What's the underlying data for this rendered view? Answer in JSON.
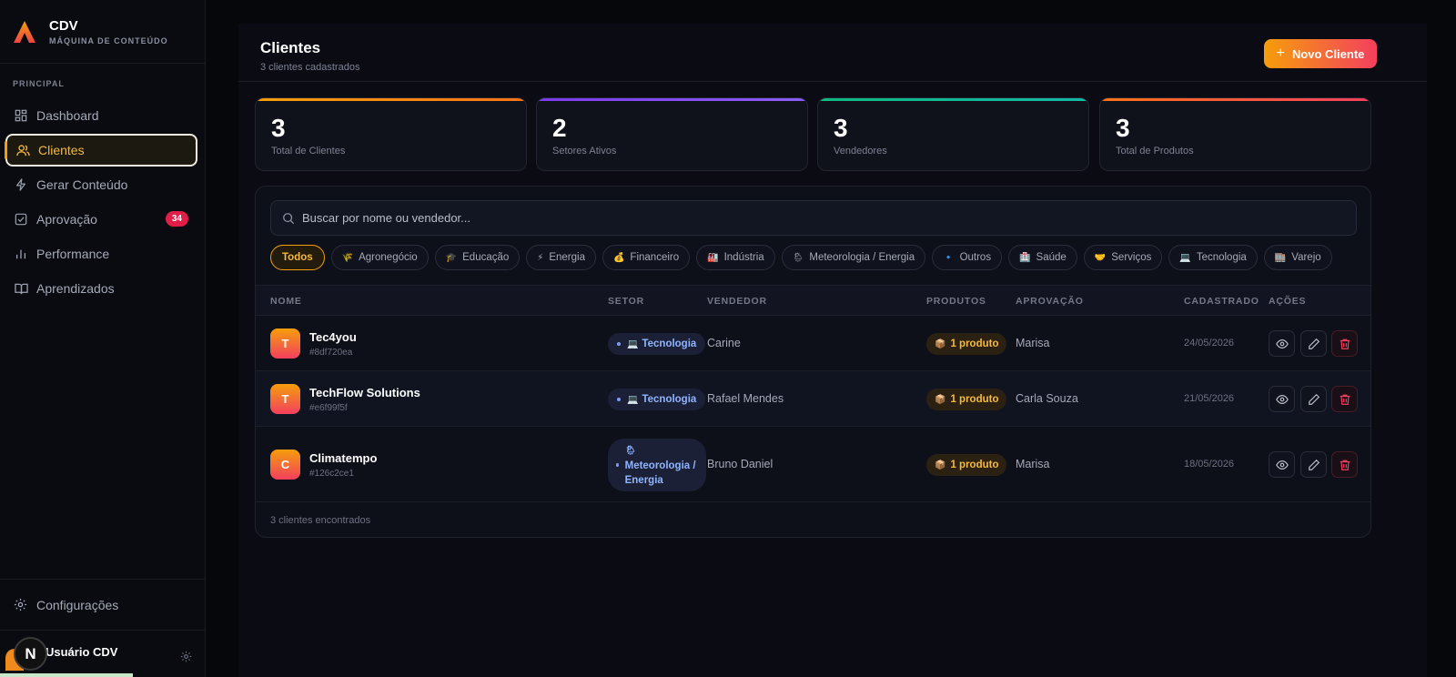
{
  "brand": {
    "name": "CDV",
    "subtitle": "MÁQUINA DE CONTEÚDO"
  },
  "sidebar": {
    "section_label": "PRINCIPAL",
    "items": [
      {
        "label": "Dashboard",
        "icon": "grid-icon"
      },
      {
        "label": "Clientes",
        "icon": "users-icon",
        "active": true
      },
      {
        "label": "Gerar Conteúdo",
        "icon": "bolt-icon"
      },
      {
        "label": "Aprovação",
        "icon": "check-square-icon",
        "badge": "34"
      },
      {
        "label": "Performance",
        "icon": "bar-chart-icon"
      },
      {
        "label": "Aprendizados",
        "icon": "book-icon"
      }
    ],
    "settings_label": "Configurações",
    "user_name": "Usuário CDV",
    "user_initial": "N"
  },
  "page": {
    "title": "Clientes",
    "subtitle": "3 clientes cadastrados",
    "new_button": "Novo Cliente",
    "new_button_icon": "+"
  },
  "stats": [
    {
      "value": "3",
      "label": "Total de Clientes",
      "color": "#f59e0b"
    },
    {
      "value": "2",
      "label": "Setores Ativos",
      "color": "#8b5cf6"
    },
    {
      "value": "3",
      "label": "Vendedores",
      "color": "#10b981"
    },
    {
      "value": "3",
      "label": "Total de Produtos",
      "color": "#f43f5e"
    }
  ],
  "search": {
    "placeholder": "Buscar por nome ou vendedor..."
  },
  "filters": [
    {
      "label": "Todos",
      "emoji": "",
      "active": true
    },
    {
      "label": "Agronegócio",
      "emoji": "🌾"
    },
    {
      "label": "Educação",
      "emoji": "🎓"
    },
    {
      "label": "Energia",
      "emoji": "⚡"
    },
    {
      "label": "Financeiro",
      "emoji": "💰"
    },
    {
      "label": "Indústria",
      "emoji": "🏭"
    },
    {
      "label": "Meteorologia / Energia",
      "emoji": "🌦"
    },
    {
      "label": "Outros",
      "emoji": "🔹"
    },
    {
      "label": "Saúde",
      "emoji": "🏥"
    },
    {
      "label": "Serviços",
      "emoji": "🤝"
    },
    {
      "label": "Tecnologia",
      "emoji": "💻"
    },
    {
      "label": "Varejo",
      "emoji": "🏬"
    }
  ],
  "table": {
    "headers": [
      "NOME",
      "SETOR",
      "VENDEDOR",
      "PRODUTOS",
      "APROVAÇÃO",
      "CADASTRADO",
      "AÇÕES"
    ],
    "rows": [
      {
        "initial": "T",
        "name": "Tec4you",
        "id": "#8df720ea",
        "setor": "Tecnologia",
        "setor_emoji": "💻",
        "vendedor": "Carine",
        "produtos": "1 produto",
        "produtos_emoji": "📦",
        "aprovacao": "Marisa",
        "cadastrado": "24/05/2026"
      },
      {
        "initial": "T",
        "name": "TechFlow Solutions",
        "id": "#e6f99f5f",
        "setor": "Tecnologia",
        "setor_emoji": "💻",
        "vendedor": "Rafael Mendes",
        "produtos": "1 produto",
        "produtos_emoji": "📦",
        "aprovacao": "Carla Souza",
        "cadastrado": "21/05/2026"
      },
      {
        "initial": "C",
        "name": "Climatempo",
        "id": "#126c2ce1",
        "setor": "Meteorologia / Energia",
        "setor_emoji": "🌦",
        "vendedor": "Bruno Daniel",
        "produtos": "1 produto",
        "produtos_emoji": "📦",
        "aprovacao": "Marisa",
        "cadastrado": "18/05/2026"
      }
    ],
    "footer": "3 clientes encontrados"
  }
}
